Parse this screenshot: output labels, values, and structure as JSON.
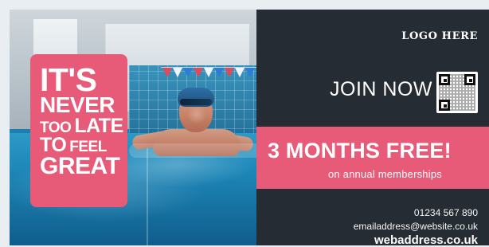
{
  "ad": {
    "headline": {
      "line1": "IT'S",
      "line2": "NEVER",
      "line3a": "TOO",
      "line3b": "LATE",
      "line4a": "TO",
      "line4b": "FEEL",
      "line5": "GREAT"
    },
    "logo": "LOGO HERE",
    "join": "JOIN NOW",
    "offer": {
      "title": "3 MONTHS FREE!",
      "subtitle": "on annual memberships"
    },
    "contact": {
      "phone": "01234 567 890",
      "email": "emailaddress@website.co.uk",
      "website": "webaddress.co.uk"
    }
  },
  "colors": {
    "background": "#e9eef3",
    "accent_pink": "#e85b78",
    "dark_panel": "#262c33"
  },
  "icons": {
    "qr": "qr-code-icon"
  }
}
